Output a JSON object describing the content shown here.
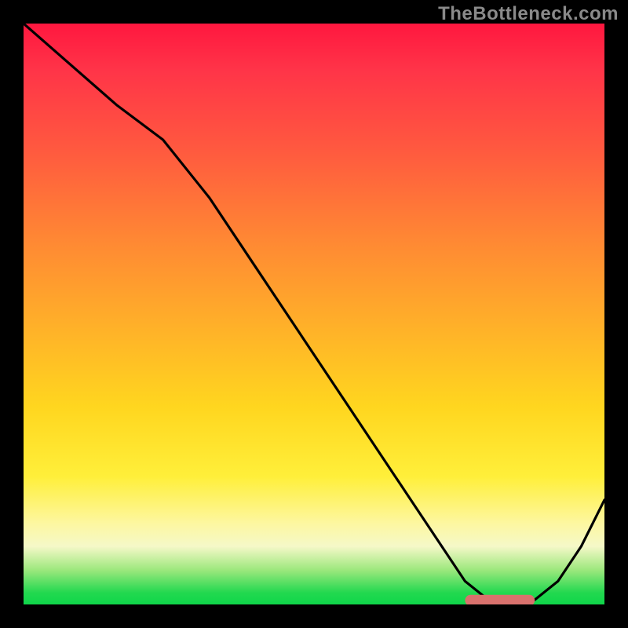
{
  "watermark": "TheBottleneck.com",
  "colors": {
    "background": "#000000",
    "watermark_text": "#8a8a8a",
    "curve": "#000000",
    "marker": "#d9716d",
    "gradient_top": "#ff173f",
    "gradient_bottom": "#0fd64a"
  },
  "chart_data": {
    "type": "line",
    "title": "",
    "xlabel": "",
    "ylabel": "",
    "xlim": [
      0,
      100
    ],
    "ylim": [
      0,
      100
    ],
    "grid": false,
    "legend": false,
    "series": [
      {
        "name": "bottleneck-curve",
        "x": [
          0,
          8,
          16,
          24,
          32,
          40,
          48,
          56,
          64,
          72,
          76,
          80,
          84,
          88,
          92,
          96,
          100
        ],
        "y": [
          100,
          93,
          86,
          80,
          70,
          58,
          46,
          34,
          22,
          10,
          4,
          0.8,
          0.5,
          0.8,
          4,
          10,
          18
        ]
      }
    ],
    "annotations": [
      {
        "type": "marker-bar",
        "x_start": 76,
        "x_end": 88,
        "y": 0.7,
        "color": "#d9716d"
      }
    ]
  }
}
